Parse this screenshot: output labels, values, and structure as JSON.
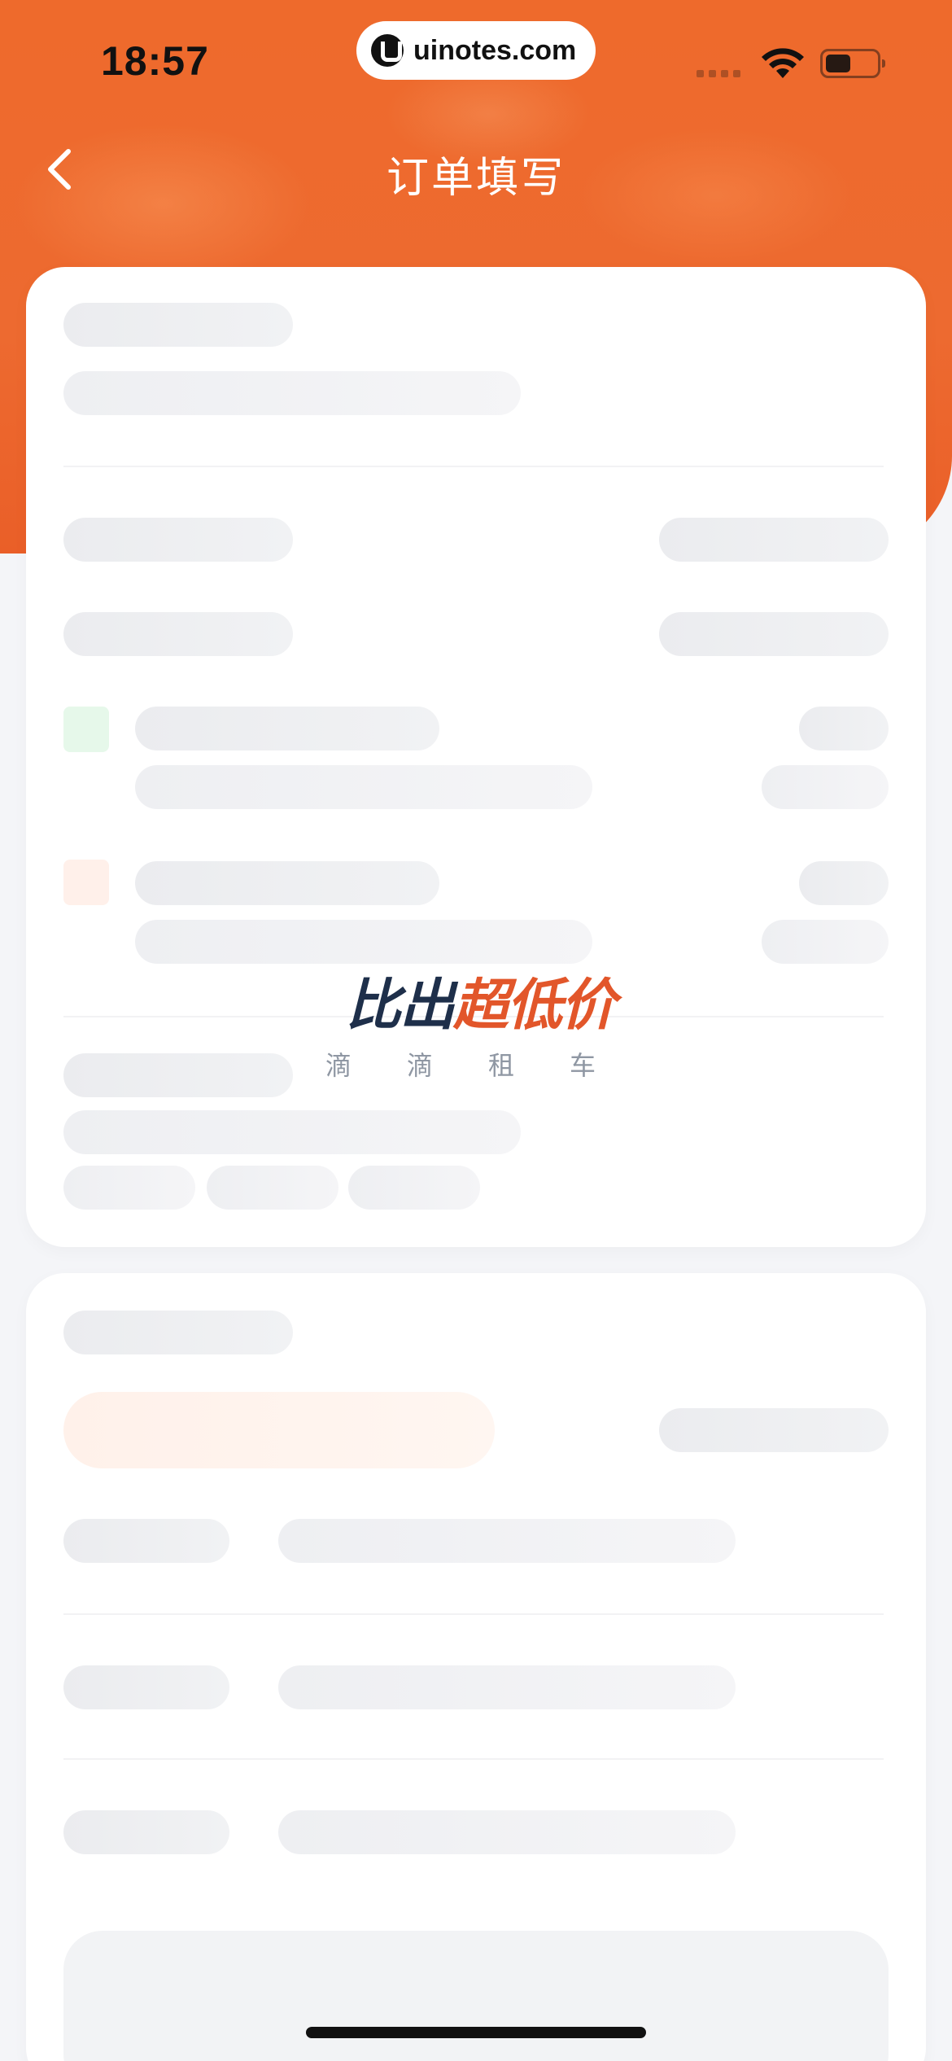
{
  "status_bar": {
    "time": "18:57",
    "url": "uinotes.com",
    "icons": [
      "signal-dots-icon",
      "wifi-icon",
      "battery-icon"
    ]
  },
  "header": {
    "back_icon": "chevron-left-icon",
    "title": "订单填写"
  },
  "promo": {
    "title_part1": "比出",
    "title_part2": "超低价",
    "subtitle": "滴滴租车"
  },
  "colors": {
    "header_orange": "#ed6a30",
    "accent_orange": "#e2562a",
    "skeleton_gray": "#ebecef",
    "navy": "#1e2f4a"
  }
}
